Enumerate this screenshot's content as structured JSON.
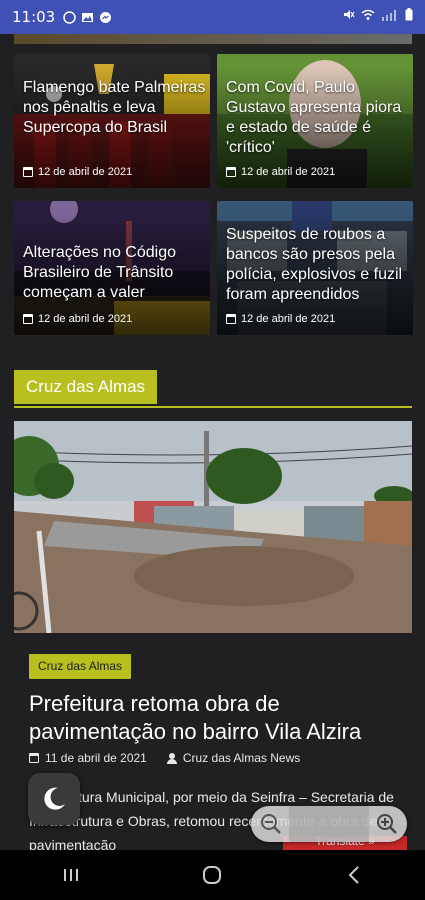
{
  "status_bar": {
    "time": "11:03"
  },
  "cards": [
    {
      "title": "Flamengo bate Palmeiras nos pênaltis e leva Supercopa do Brasil",
      "date": "12 de abril de 2021"
    },
    {
      "title": "Com Covid, Paulo Gustavo apresenta piora e estado de saúde é 'crítico'",
      "date": "12 de abril de 2021"
    },
    {
      "title": "Alterações no Código Brasileiro de Trânsito começam a valer",
      "date": "12 de abril de 2021"
    },
    {
      "title": "Suspeitos de roubos a bancos são presos pela polícia, explosivos e fuzil foram apreendidos",
      "date": "12 de abril de 2021"
    }
  ],
  "section": {
    "title": "Cruz das Almas"
  },
  "article": {
    "category": "Cruz das Almas",
    "headline": "Prefeitura retoma obra de pavimentação no bairro Vila Alzira",
    "date": "11 de abril de 2021",
    "author": "Cruz das Almas News",
    "excerpt": "A Prefeitura Municipal, por meio da Seinfra – Secretaria de Infraestrutura e Obras, retomou recentemente a obra de pavimentação"
  },
  "widgets": {
    "translate_label": "Translate »"
  },
  "colors": {
    "accent": "#b8bf1f",
    "status_bar": "#3f51b5",
    "translate": "#c62828"
  }
}
